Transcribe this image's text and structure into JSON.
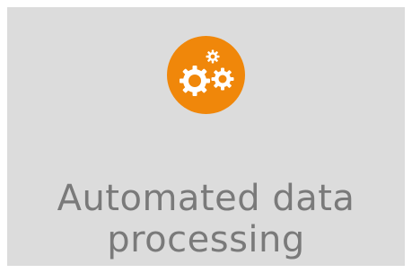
{
  "tile": {
    "icon": "gears-icon",
    "line1": "Automated data",
    "line2": "processing"
  },
  "colors": {
    "tile_background": "#dcdcdc",
    "icon_background": "#f0870a",
    "text": "#7a7a7a",
    "icon_foreground": "#ffffff"
  }
}
